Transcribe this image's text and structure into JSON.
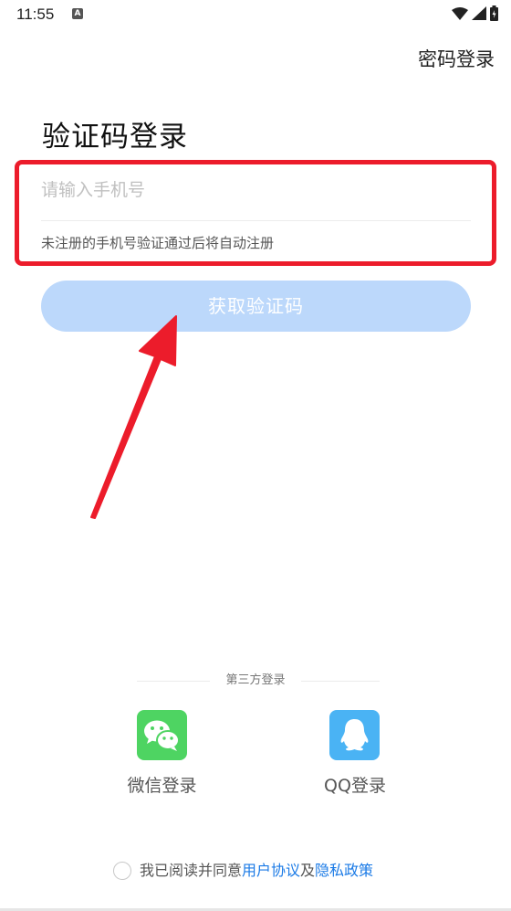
{
  "status_bar": {
    "time": "11:55",
    "notification_icon": "a-box-icon",
    "icons": [
      "wifi-icon",
      "signal-icon",
      "battery-icon"
    ]
  },
  "header": {
    "password_login_label": "密码登录"
  },
  "main": {
    "title": "验证码登录",
    "phone_input": {
      "value": "",
      "placeholder": "请输入手机号"
    },
    "register_hint": "未注册的手机号验证通过后将自动注册",
    "get_code_button": "获取验证码"
  },
  "third_party": {
    "label": "第三方登录",
    "options": [
      {
        "label": "微信登录",
        "icon": "wechat-icon",
        "color": "#4ed462"
      },
      {
        "label": "QQ登录",
        "icon": "qq-icon",
        "color": "#4ab3f4"
      }
    ]
  },
  "agreement": {
    "prefix": "我已阅读并同意",
    "user_agreement": "用户协议",
    "conjunction": "及",
    "privacy_policy": "隐私政策",
    "checked": false
  },
  "colors": {
    "accent_link": "#1a7ae6",
    "button_disabled": "#bcd8fb",
    "annotation_red": "#ec1c2b"
  }
}
